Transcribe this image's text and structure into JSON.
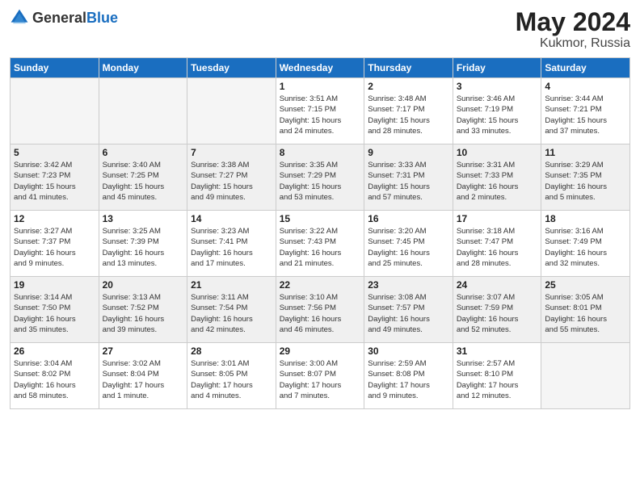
{
  "header": {
    "logo_general": "General",
    "logo_blue": "Blue",
    "title": "May 2024",
    "location": "Kukmor, Russia"
  },
  "weekdays": [
    "Sunday",
    "Monday",
    "Tuesday",
    "Wednesday",
    "Thursday",
    "Friday",
    "Saturday"
  ],
  "weeks": [
    [
      {
        "day": "",
        "info": ""
      },
      {
        "day": "",
        "info": ""
      },
      {
        "day": "",
        "info": ""
      },
      {
        "day": "1",
        "info": "Sunrise: 3:51 AM\nSunset: 7:15 PM\nDaylight: 15 hours\nand 24 minutes."
      },
      {
        "day": "2",
        "info": "Sunrise: 3:48 AM\nSunset: 7:17 PM\nDaylight: 15 hours\nand 28 minutes."
      },
      {
        "day": "3",
        "info": "Sunrise: 3:46 AM\nSunset: 7:19 PM\nDaylight: 15 hours\nand 33 minutes."
      },
      {
        "day": "4",
        "info": "Sunrise: 3:44 AM\nSunset: 7:21 PM\nDaylight: 15 hours\nand 37 minutes."
      }
    ],
    [
      {
        "day": "5",
        "info": "Sunrise: 3:42 AM\nSunset: 7:23 PM\nDaylight: 15 hours\nand 41 minutes."
      },
      {
        "day": "6",
        "info": "Sunrise: 3:40 AM\nSunset: 7:25 PM\nDaylight: 15 hours\nand 45 minutes."
      },
      {
        "day": "7",
        "info": "Sunrise: 3:38 AM\nSunset: 7:27 PM\nDaylight: 15 hours\nand 49 minutes."
      },
      {
        "day": "8",
        "info": "Sunrise: 3:35 AM\nSunset: 7:29 PM\nDaylight: 15 hours\nand 53 minutes."
      },
      {
        "day": "9",
        "info": "Sunrise: 3:33 AM\nSunset: 7:31 PM\nDaylight: 15 hours\nand 57 minutes."
      },
      {
        "day": "10",
        "info": "Sunrise: 3:31 AM\nSunset: 7:33 PM\nDaylight: 16 hours\nand 2 minutes."
      },
      {
        "day": "11",
        "info": "Sunrise: 3:29 AM\nSunset: 7:35 PM\nDaylight: 16 hours\nand 5 minutes."
      }
    ],
    [
      {
        "day": "12",
        "info": "Sunrise: 3:27 AM\nSunset: 7:37 PM\nDaylight: 16 hours\nand 9 minutes."
      },
      {
        "day": "13",
        "info": "Sunrise: 3:25 AM\nSunset: 7:39 PM\nDaylight: 16 hours\nand 13 minutes."
      },
      {
        "day": "14",
        "info": "Sunrise: 3:23 AM\nSunset: 7:41 PM\nDaylight: 16 hours\nand 17 minutes."
      },
      {
        "day": "15",
        "info": "Sunrise: 3:22 AM\nSunset: 7:43 PM\nDaylight: 16 hours\nand 21 minutes."
      },
      {
        "day": "16",
        "info": "Sunrise: 3:20 AM\nSunset: 7:45 PM\nDaylight: 16 hours\nand 25 minutes."
      },
      {
        "day": "17",
        "info": "Sunrise: 3:18 AM\nSunset: 7:47 PM\nDaylight: 16 hours\nand 28 minutes."
      },
      {
        "day": "18",
        "info": "Sunrise: 3:16 AM\nSunset: 7:49 PM\nDaylight: 16 hours\nand 32 minutes."
      }
    ],
    [
      {
        "day": "19",
        "info": "Sunrise: 3:14 AM\nSunset: 7:50 PM\nDaylight: 16 hours\nand 35 minutes."
      },
      {
        "day": "20",
        "info": "Sunrise: 3:13 AM\nSunset: 7:52 PM\nDaylight: 16 hours\nand 39 minutes."
      },
      {
        "day": "21",
        "info": "Sunrise: 3:11 AM\nSunset: 7:54 PM\nDaylight: 16 hours\nand 42 minutes."
      },
      {
        "day": "22",
        "info": "Sunrise: 3:10 AM\nSunset: 7:56 PM\nDaylight: 16 hours\nand 46 minutes."
      },
      {
        "day": "23",
        "info": "Sunrise: 3:08 AM\nSunset: 7:57 PM\nDaylight: 16 hours\nand 49 minutes."
      },
      {
        "day": "24",
        "info": "Sunrise: 3:07 AM\nSunset: 7:59 PM\nDaylight: 16 hours\nand 52 minutes."
      },
      {
        "day": "25",
        "info": "Sunrise: 3:05 AM\nSunset: 8:01 PM\nDaylight: 16 hours\nand 55 minutes."
      }
    ],
    [
      {
        "day": "26",
        "info": "Sunrise: 3:04 AM\nSunset: 8:02 PM\nDaylight: 16 hours\nand 58 minutes."
      },
      {
        "day": "27",
        "info": "Sunrise: 3:02 AM\nSunset: 8:04 PM\nDaylight: 17 hours\nand 1 minute."
      },
      {
        "day": "28",
        "info": "Sunrise: 3:01 AM\nSunset: 8:05 PM\nDaylight: 17 hours\nand 4 minutes."
      },
      {
        "day": "29",
        "info": "Sunrise: 3:00 AM\nSunset: 8:07 PM\nDaylight: 17 hours\nand 7 minutes."
      },
      {
        "day": "30",
        "info": "Sunrise: 2:59 AM\nSunset: 8:08 PM\nDaylight: 17 hours\nand 9 minutes."
      },
      {
        "day": "31",
        "info": "Sunrise: 2:57 AM\nSunset: 8:10 PM\nDaylight: 17 hours\nand 12 minutes."
      },
      {
        "day": "",
        "info": ""
      }
    ]
  ]
}
